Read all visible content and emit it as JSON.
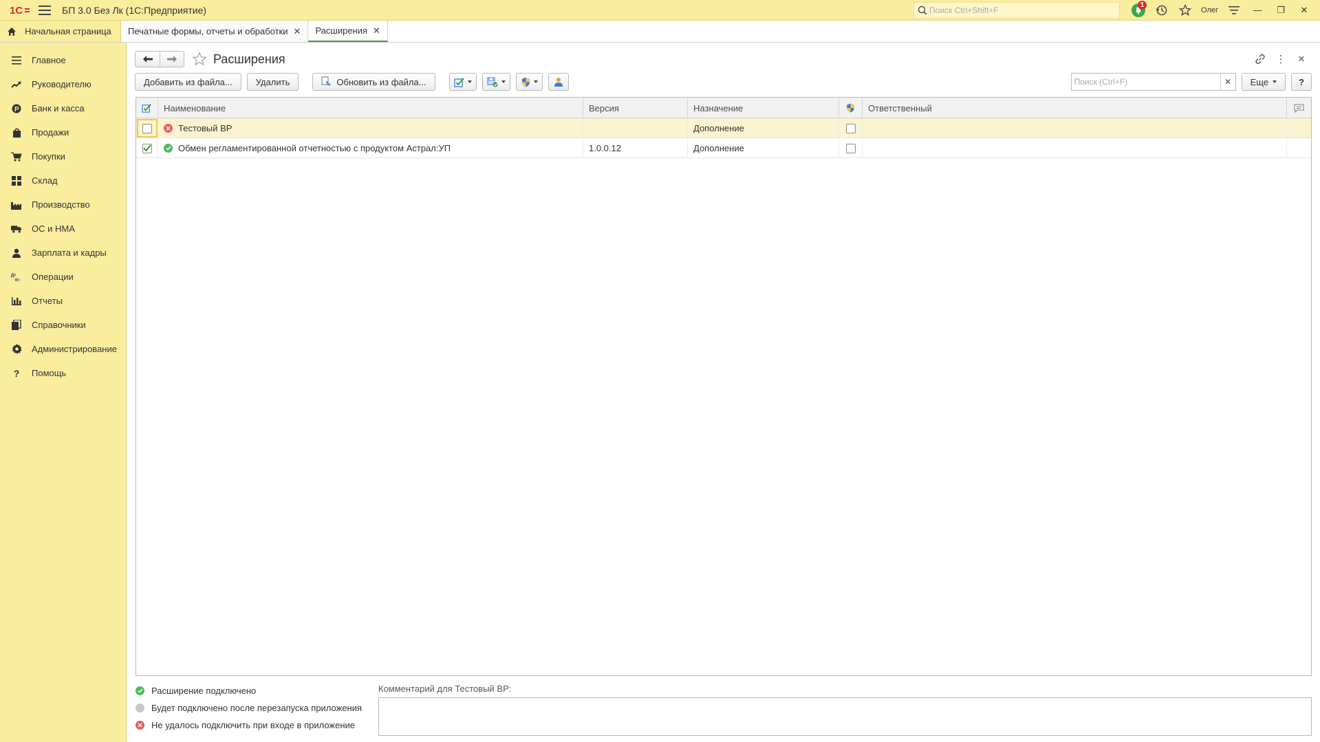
{
  "titlebar": {
    "app_title": "БП 3.0 Без Лк  (1С:Предприятие)",
    "search_placeholder": "Поиск Ctrl+Shift+F",
    "notifications_count": "1",
    "user_name": "Олег"
  },
  "tabs": {
    "home_label": "Начальная страница",
    "items": [
      {
        "label": "Печатные формы, отчеты и обработки"
      },
      {
        "label": "Расширения"
      }
    ]
  },
  "sidebar": {
    "items": [
      {
        "label": "Главное",
        "icon": "menu-lines-icon"
      },
      {
        "label": "Руководителю",
        "icon": "trend-chart-icon"
      },
      {
        "label": "Банк и касса",
        "icon": "ruble-coin-icon"
      },
      {
        "label": "Продажи",
        "icon": "shopping-bag-icon"
      },
      {
        "label": "Покупки",
        "icon": "cart-icon"
      },
      {
        "label": "Склад",
        "icon": "warehouse-grid-icon"
      },
      {
        "label": "Производство",
        "icon": "factory-icon"
      },
      {
        "label": "ОС и НМА",
        "icon": "truck-icon"
      },
      {
        "label": "Зарплата и кадры",
        "icon": "person-icon"
      },
      {
        "label": "Операции",
        "icon": "debit-credit-icon"
      },
      {
        "label": "Отчеты",
        "icon": "bar-chart-icon"
      },
      {
        "label": "Справочники",
        "icon": "books-icon"
      },
      {
        "label": "Администрирование",
        "icon": "gear-icon"
      },
      {
        "label": "Помощь",
        "icon": "question-icon"
      }
    ]
  },
  "page": {
    "title": "Расширения"
  },
  "toolbar": {
    "add_from_file": "Добавить из файла...",
    "delete": "Удалить",
    "update_from_file": "Обновить из файла...",
    "search_placeholder": "Поиск (Ctrl+F)",
    "more": "Еще",
    "help": "?"
  },
  "table": {
    "columns": {
      "name": "Наименование",
      "version": "Версия",
      "purpose": "Назначение",
      "responsible": "Ответственный"
    },
    "rows": [
      {
        "enabled": false,
        "status": "error",
        "name": "Тестовый ВР",
        "version": "",
        "purpose": "Дополнение",
        "safe_mode": false,
        "responsible": ""
      },
      {
        "enabled": true,
        "status": "ok",
        "name": "Обмен регламентированной отчетностью с продуктом Астрал:УП",
        "version": "1.0.0.12",
        "purpose": "Дополнение",
        "safe_mode": false,
        "responsible": ""
      }
    ]
  },
  "legend": {
    "connected": "Расширение подключено",
    "after_restart": "Будет подключено после перезапуска приложения",
    "failed": "Не удалось подключить при входе в приложение"
  },
  "comment": {
    "label": "Комментарий для Тестовый ВР:",
    "value": ""
  },
  "colors": {
    "panel_yellow": "#fbed9e",
    "ok_green": "#3bb54a",
    "error_red": "#e04848",
    "pending_gray": "#c8c8c8",
    "selected_row": "#fcf4d0"
  }
}
